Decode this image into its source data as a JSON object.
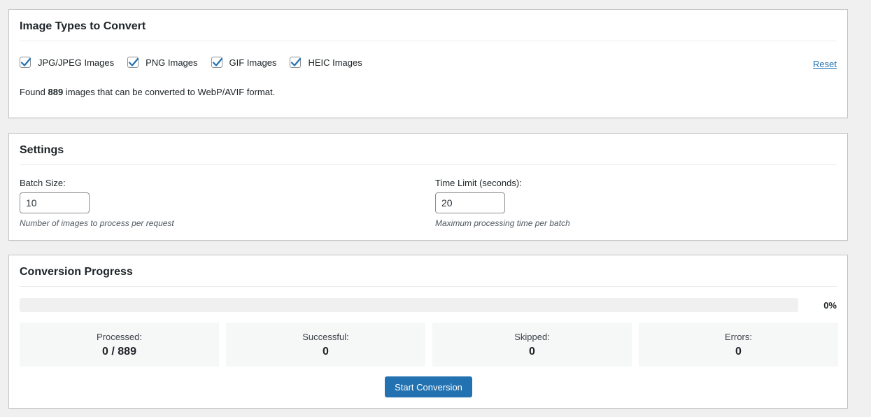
{
  "image_types": {
    "title": "Image Types to Convert",
    "options": [
      {
        "label": "JPG/JPEG Images",
        "checked": true
      },
      {
        "label": "PNG Images",
        "checked": true
      },
      {
        "label": "GIF Images",
        "checked": true
      },
      {
        "label": "HEIC Images",
        "checked": true
      }
    ],
    "reset_label": "Reset",
    "found_prefix": "Found",
    "found_count": "889",
    "found_suffix": "images that can be converted to WebP/AVIF format."
  },
  "settings": {
    "title": "Settings",
    "batch_size": {
      "label": "Batch Size:",
      "value": "10",
      "description": "Number of images to process per request"
    },
    "time_limit": {
      "label": "Time Limit (seconds):",
      "value": "20",
      "description": "Maximum processing time per batch"
    }
  },
  "progress": {
    "title": "Conversion Progress",
    "percent_label": "0%",
    "percent_value": 0,
    "stats": [
      {
        "label": "Processed:",
        "value": "0 / 889"
      },
      {
        "label": "Successful:",
        "value": "0"
      },
      {
        "label": "Skipped:",
        "value": "0"
      },
      {
        "label": "Errors:",
        "value": "0"
      }
    ],
    "start_button": "Start Conversion"
  },
  "colors": {
    "accent": "#2271b1",
    "background": "#f0f0f1",
    "panel_border": "#c3c4c7"
  }
}
